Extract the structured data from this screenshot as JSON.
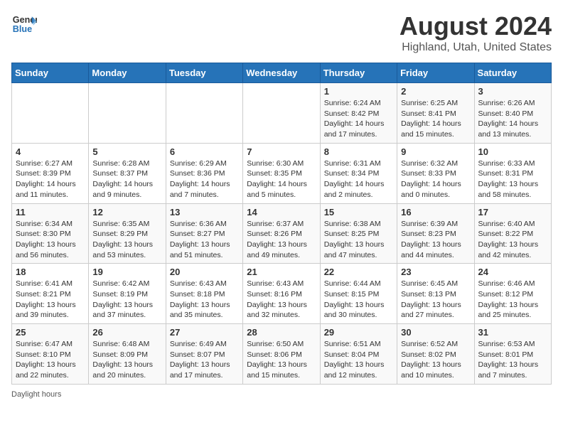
{
  "header": {
    "logo_line1": "General",
    "logo_line2": "Blue",
    "title": "August 2024",
    "subtitle": "Highland, Utah, United States"
  },
  "days_of_week": [
    "Sunday",
    "Monday",
    "Tuesday",
    "Wednesday",
    "Thursday",
    "Friday",
    "Saturday"
  ],
  "weeks": [
    [
      {
        "day": "",
        "info": ""
      },
      {
        "day": "",
        "info": ""
      },
      {
        "day": "",
        "info": ""
      },
      {
        "day": "",
        "info": ""
      },
      {
        "day": "1",
        "info": "Sunrise: 6:24 AM\nSunset: 8:42 PM\nDaylight: 14 hours\nand 17 minutes."
      },
      {
        "day": "2",
        "info": "Sunrise: 6:25 AM\nSunset: 8:41 PM\nDaylight: 14 hours\nand 15 minutes."
      },
      {
        "day": "3",
        "info": "Sunrise: 6:26 AM\nSunset: 8:40 PM\nDaylight: 14 hours\nand 13 minutes."
      }
    ],
    [
      {
        "day": "4",
        "info": "Sunrise: 6:27 AM\nSunset: 8:39 PM\nDaylight: 14 hours\nand 11 minutes."
      },
      {
        "day": "5",
        "info": "Sunrise: 6:28 AM\nSunset: 8:37 PM\nDaylight: 14 hours\nand 9 minutes."
      },
      {
        "day": "6",
        "info": "Sunrise: 6:29 AM\nSunset: 8:36 PM\nDaylight: 14 hours\nand 7 minutes."
      },
      {
        "day": "7",
        "info": "Sunrise: 6:30 AM\nSunset: 8:35 PM\nDaylight: 14 hours\nand 5 minutes."
      },
      {
        "day": "8",
        "info": "Sunrise: 6:31 AM\nSunset: 8:34 PM\nDaylight: 14 hours\nand 2 minutes."
      },
      {
        "day": "9",
        "info": "Sunrise: 6:32 AM\nSunset: 8:33 PM\nDaylight: 14 hours\nand 0 minutes."
      },
      {
        "day": "10",
        "info": "Sunrise: 6:33 AM\nSunset: 8:31 PM\nDaylight: 13 hours\nand 58 minutes."
      }
    ],
    [
      {
        "day": "11",
        "info": "Sunrise: 6:34 AM\nSunset: 8:30 PM\nDaylight: 13 hours\nand 56 minutes."
      },
      {
        "day": "12",
        "info": "Sunrise: 6:35 AM\nSunset: 8:29 PM\nDaylight: 13 hours\nand 53 minutes."
      },
      {
        "day": "13",
        "info": "Sunrise: 6:36 AM\nSunset: 8:27 PM\nDaylight: 13 hours\nand 51 minutes."
      },
      {
        "day": "14",
        "info": "Sunrise: 6:37 AM\nSunset: 8:26 PM\nDaylight: 13 hours\nand 49 minutes."
      },
      {
        "day": "15",
        "info": "Sunrise: 6:38 AM\nSunset: 8:25 PM\nDaylight: 13 hours\nand 47 minutes."
      },
      {
        "day": "16",
        "info": "Sunrise: 6:39 AM\nSunset: 8:23 PM\nDaylight: 13 hours\nand 44 minutes."
      },
      {
        "day": "17",
        "info": "Sunrise: 6:40 AM\nSunset: 8:22 PM\nDaylight: 13 hours\nand 42 minutes."
      }
    ],
    [
      {
        "day": "18",
        "info": "Sunrise: 6:41 AM\nSunset: 8:21 PM\nDaylight: 13 hours\nand 39 minutes."
      },
      {
        "day": "19",
        "info": "Sunrise: 6:42 AM\nSunset: 8:19 PM\nDaylight: 13 hours\nand 37 minutes."
      },
      {
        "day": "20",
        "info": "Sunrise: 6:43 AM\nSunset: 8:18 PM\nDaylight: 13 hours\nand 35 minutes."
      },
      {
        "day": "21",
        "info": "Sunrise: 6:43 AM\nSunset: 8:16 PM\nDaylight: 13 hours\nand 32 minutes."
      },
      {
        "day": "22",
        "info": "Sunrise: 6:44 AM\nSunset: 8:15 PM\nDaylight: 13 hours\nand 30 minutes."
      },
      {
        "day": "23",
        "info": "Sunrise: 6:45 AM\nSunset: 8:13 PM\nDaylight: 13 hours\nand 27 minutes."
      },
      {
        "day": "24",
        "info": "Sunrise: 6:46 AM\nSunset: 8:12 PM\nDaylight: 13 hours\nand 25 minutes."
      }
    ],
    [
      {
        "day": "25",
        "info": "Sunrise: 6:47 AM\nSunset: 8:10 PM\nDaylight: 13 hours\nand 22 minutes."
      },
      {
        "day": "26",
        "info": "Sunrise: 6:48 AM\nSunset: 8:09 PM\nDaylight: 13 hours\nand 20 minutes."
      },
      {
        "day": "27",
        "info": "Sunrise: 6:49 AM\nSunset: 8:07 PM\nDaylight: 13 hours\nand 17 minutes."
      },
      {
        "day": "28",
        "info": "Sunrise: 6:50 AM\nSunset: 8:06 PM\nDaylight: 13 hours\nand 15 minutes."
      },
      {
        "day": "29",
        "info": "Sunrise: 6:51 AM\nSunset: 8:04 PM\nDaylight: 13 hours\nand 12 minutes."
      },
      {
        "day": "30",
        "info": "Sunrise: 6:52 AM\nSunset: 8:02 PM\nDaylight: 13 hours\nand 10 minutes."
      },
      {
        "day": "31",
        "info": "Sunrise: 6:53 AM\nSunset: 8:01 PM\nDaylight: 13 hours\nand 7 minutes."
      }
    ]
  ],
  "footer": {
    "text": "Daylight hours"
  }
}
